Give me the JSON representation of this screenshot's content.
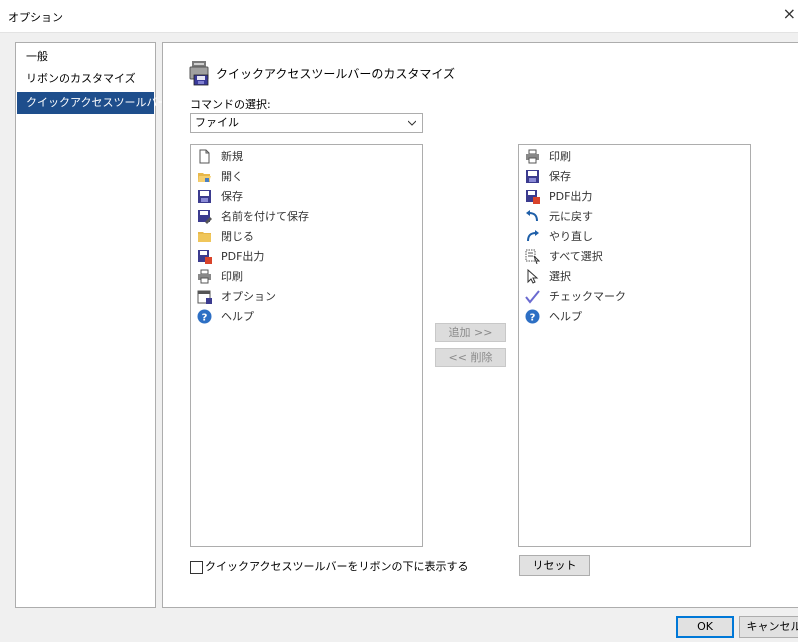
{
  "window": {
    "title": "オプション",
    "close_glyph": "×"
  },
  "nav": {
    "items": [
      {
        "label": "一般",
        "selected": false
      },
      {
        "label": "リボンのカスタマイズ",
        "selected": false
      },
      {
        "label": "クイックアクセスツールバー",
        "selected": true
      }
    ]
  },
  "main": {
    "section_title": "クイックアクセスツールバーのカスタマイズ",
    "command_label": "コマンドの選択:",
    "command_select": {
      "value": "ファイル"
    },
    "available_commands": [
      {
        "label": "新規",
        "icon": "new-document-icon"
      },
      {
        "label": "開く",
        "icon": "open-folder-icon"
      },
      {
        "label": "保存",
        "icon": "save-icon"
      },
      {
        "label": "名前を付けて保存",
        "icon": "save-as-icon"
      },
      {
        "label": "閉じる",
        "icon": "close-folder-icon"
      },
      {
        "label": "PDF出力",
        "icon": "pdf-export-icon"
      },
      {
        "label": "印刷",
        "icon": "print-icon"
      },
      {
        "label": "オプション",
        "icon": "options-icon"
      },
      {
        "label": "ヘルプ",
        "icon": "help-icon"
      }
    ],
    "toolbar_commands": [
      {
        "label": "印刷",
        "icon": "print-icon"
      },
      {
        "label": "保存",
        "icon": "save-icon"
      },
      {
        "label": "PDF出力",
        "icon": "pdf-export-icon"
      },
      {
        "label": "元に戻す",
        "icon": "undo-icon"
      },
      {
        "label": "やり直し",
        "icon": "redo-icon"
      },
      {
        "label": "すべて選択",
        "icon": "select-all-icon"
      },
      {
        "label": "選択",
        "icon": "pointer-icon"
      },
      {
        "label": "チェックマーク",
        "icon": "checkmark-icon"
      },
      {
        "label": "ヘルプ",
        "icon": "help-icon"
      }
    ],
    "add_button": "追加 >>",
    "remove_button": "<< 削除",
    "reset_button": "リセット",
    "below_ribbon_checkbox": {
      "label": "クイックアクセスツールバーをリボンの下に表示する",
      "checked": false
    }
  },
  "footer": {
    "ok_label": "OK",
    "cancel_label": "キャンセル"
  },
  "colors": {
    "selection": "#1e4e8c",
    "accent": "#0078d7"
  }
}
